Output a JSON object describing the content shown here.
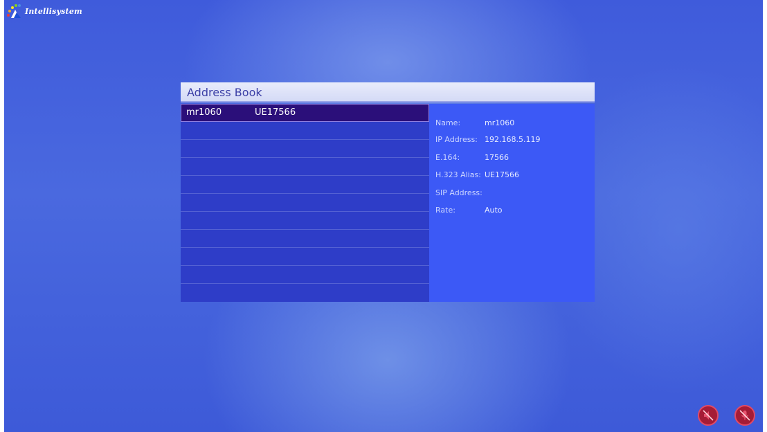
{
  "app": {
    "logo_text": "Intellisystem"
  },
  "dialog": {
    "title": "Address Book"
  },
  "list": {
    "rows": [
      {
        "name": "mr1060",
        "alias": "UE17566",
        "selected": true
      },
      {
        "name": "",
        "alias": ""
      },
      {
        "name": "",
        "alias": ""
      },
      {
        "name": "",
        "alias": ""
      },
      {
        "name": "",
        "alias": ""
      },
      {
        "name": "",
        "alias": ""
      },
      {
        "name": "",
        "alias": ""
      },
      {
        "name": "",
        "alias": ""
      },
      {
        "name": "",
        "alias": ""
      },
      {
        "name": "",
        "alias": ""
      },
      {
        "name": "",
        "alias": ""
      }
    ]
  },
  "details": [
    {
      "label": "Name:",
      "value": "mr1060"
    },
    {
      "label": "IP Address:",
      "value": "192.168.5.119"
    },
    {
      "label": "E.164:",
      "value": "17566"
    },
    {
      "label": "H.323 Alias:",
      "value": "UE17566"
    },
    {
      "label": "SIP Address:",
      "value": ""
    },
    {
      "label": "Rate:",
      "value": "Auto"
    }
  ],
  "status_icons": [
    {
      "icon": "speaker-muted-icon"
    },
    {
      "icon": "microphone-muted-icon"
    }
  ],
  "colors": {
    "list_bg": "#2e3dc8",
    "selected_row": "#2b0f7a",
    "detail_bg": "#3c59f6",
    "mute_red": "#a51c36"
  }
}
